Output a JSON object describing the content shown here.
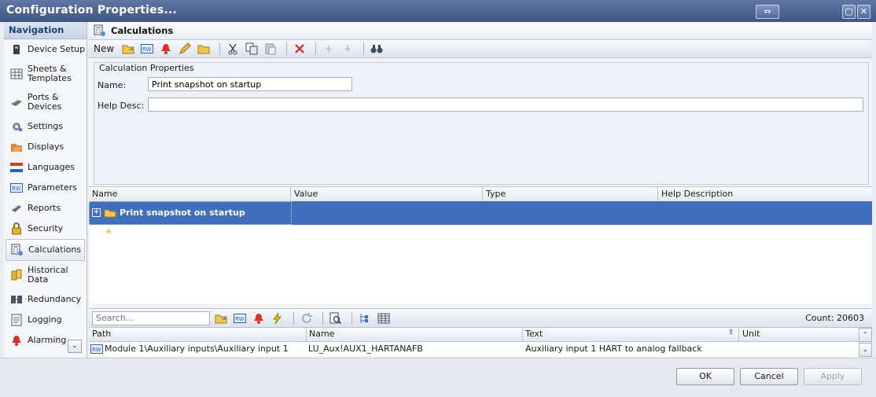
{
  "window": {
    "title": "Configuration Properties..."
  },
  "nav": {
    "header": "Navigation",
    "items": [
      {
        "label": "Device Setup",
        "icon": "device-icon"
      },
      {
        "label": "Sheets & Templates",
        "icon": "sheets-icon"
      },
      {
        "label": "Ports & Devices",
        "icon": "ports-icon"
      },
      {
        "label": "Settings",
        "icon": "gear-icon"
      },
      {
        "label": "Displays",
        "icon": "displays-icon"
      },
      {
        "label": "Languages",
        "icon": "flag-icon"
      },
      {
        "label": "Parameters",
        "icon": "rw-icon"
      },
      {
        "label": "Reports",
        "icon": "reports-icon"
      },
      {
        "label": "Security",
        "icon": "lock-icon"
      },
      {
        "label": "Calculations",
        "icon": "calculator-icon"
      },
      {
        "label": "Historical Data",
        "icon": "database-icon"
      },
      {
        "label": "Redundancy",
        "icon": "redundancy-icon"
      },
      {
        "label": "Logging",
        "icon": "log-icon"
      },
      {
        "label": "Alarming",
        "icon": "bell-icon"
      }
    ],
    "selected": "Calculations"
  },
  "section": {
    "title": "Calculations"
  },
  "toolbar": {
    "new_label": "New"
  },
  "props": {
    "legend": "Calculation Properties",
    "name_label": "Name:",
    "name_value": "Print snapshot on startup",
    "help_label": "Help Desc:",
    "help_value": ""
  },
  "grid": {
    "columns": [
      "Name",
      "Value",
      "Type",
      "Help Description"
    ],
    "rows": [
      {
        "name": "Print snapshot on startup"
      }
    ]
  },
  "search": {
    "placeholder": "Search...",
    "count": "Count: 20603"
  },
  "results": {
    "columns": [
      "Path",
      "Name",
      "Text",
      "Unit"
    ],
    "rows": [
      {
        "path": "Module 1\\Auxiliary inputs\\Auxiliary input 1",
        "name": "LU_Aux!AUX1_HARTANAFB",
        "text": "Auxiliary input 1 HART to analog fallback",
        "unit": ""
      }
    ]
  },
  "buttons": {
    "ok": "OK",
    "cancel": "Cancel",
    "apply": "Apply"
  },
  "colors": {
    "title_bar": "#4a6191",
    "selection": "#3f6fbd"
  }
}
